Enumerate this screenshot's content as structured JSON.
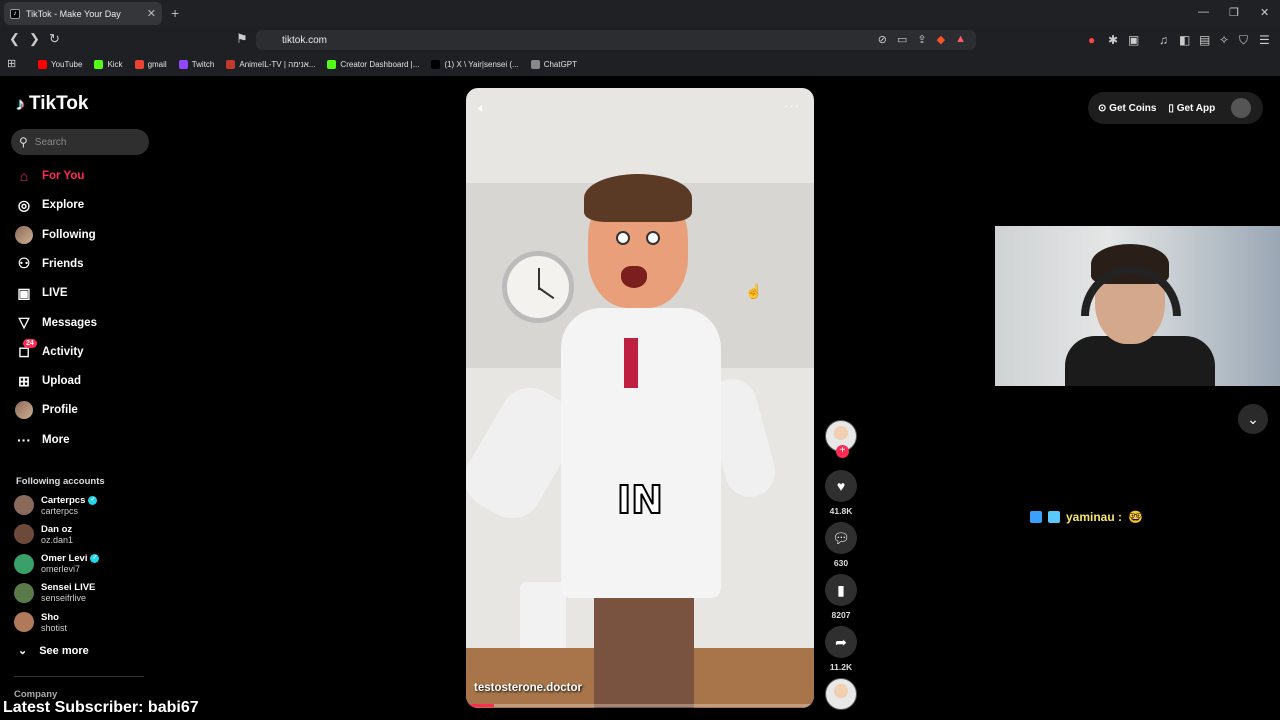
{
  "browser": {
    "tab_title": "TikTok - Make Your Day",
    "tab_favicon": "tiktok-icon",
    "new_tab_icon": "+",
    "url": "tiktok.com",
    "bookmarks": [
      {
        "label": "YouTube",
        "icon": "youtube-icon",
        "color": "#ff0000"
      },
      {
        "label": "Kick",
        "icon": "kick-icon",
        "color": "#53fc18"
      },
      {
        "label": "gmail",
        "icon": "gmail-icon",
        "color": "#ea4335"
      },
      {
        "label": "Twitch",
        "icon": "twitch-icon",
        "color": "#9146ff"
      },
      {
        "label": "AnimeIL-TV | אנימה...",
        "icon": "anime-icon",
        "color": "#c0392b"
      },
      {
        "label": "Creator Dashboard |...",
        "icon": "kick-icon",
        "color": "#53fc18"
      },
      {
        "label": "(1) X \\ Yair|sensei (...",
        "icon": "x-icon",
        "color": "#000000"
      },
      {
        "label": "ChatGPT",
        "icon": "chatgpt-icon",
        "color": "#888888"
      }
    ]
  },
  "sidebar": {
    "logo": "TikTok",
    "search_placeholder": "Search",
    "nav": [
      {
        "label": "For You",
        "icon": "home-icon",
        "active": true
      },
      {
        "label": "Explore",
        "icon": "compass-icon"
      },
      {
        "label": "Following",
        "icon": "following-avatar-icon"
      },
      {
        "label": "Friends",
        "icon": "friends-icon"
      },
      {
        "label": "LIVE",
        "icon": "live-icon"
      },
      {
        "label": "Messages",
        "icon": "messages-icon"
      },
      {
        "label": "Activity",
        "icon": "activity-icon",
        "badge": "24"
      },
      {
        "label": "Upload",
        "icon": "upload-icon"
      },
      {
        "label": "Profile",
        "icon": "profile-avatar-icon"
      },
      {
        "label": "More",
        "icon": "more-icon"
      }
    ],
    "following_title": "Following accounts",
    "following": [
      {
        "name": "Carterpcs",
        "handle": "carterpcs",
        "verified": true
      },
      {
        "name": "Dan oz",
        "handle": "oz.dan1",
        "verified": false
      },
      {
        "name": "Omer Levi",
        "handle": "omerlevi7",
        "verified": true
      },
      {
        "name": "Sensei LIVE",
        "handle": "senseifrlive",
        "verified": false
      },
      {
        "name": "Sho",
        "handle": "shotist",
        "verified": false
      }
    ],
    "see_more": "See more",
    "company": "Company"
  },
  "video": {
    "caption_word": "IN",
    "handle": "testosterone.doctor",
    "progress": 0.08
  },
  "actions": {
    "likes": "41.8K",
    "comments": "630",
    "saves": "8207",
    "shares": "11.2K"
  },
  "topright": {
    "get_coins": "Get Coins",
    "get_app": "Get App"
  },
  "overlay": {
    "chat_user": "yaminau :",
    "latest_subscriber": "Latest Subscriber: babi67"
  }
}
